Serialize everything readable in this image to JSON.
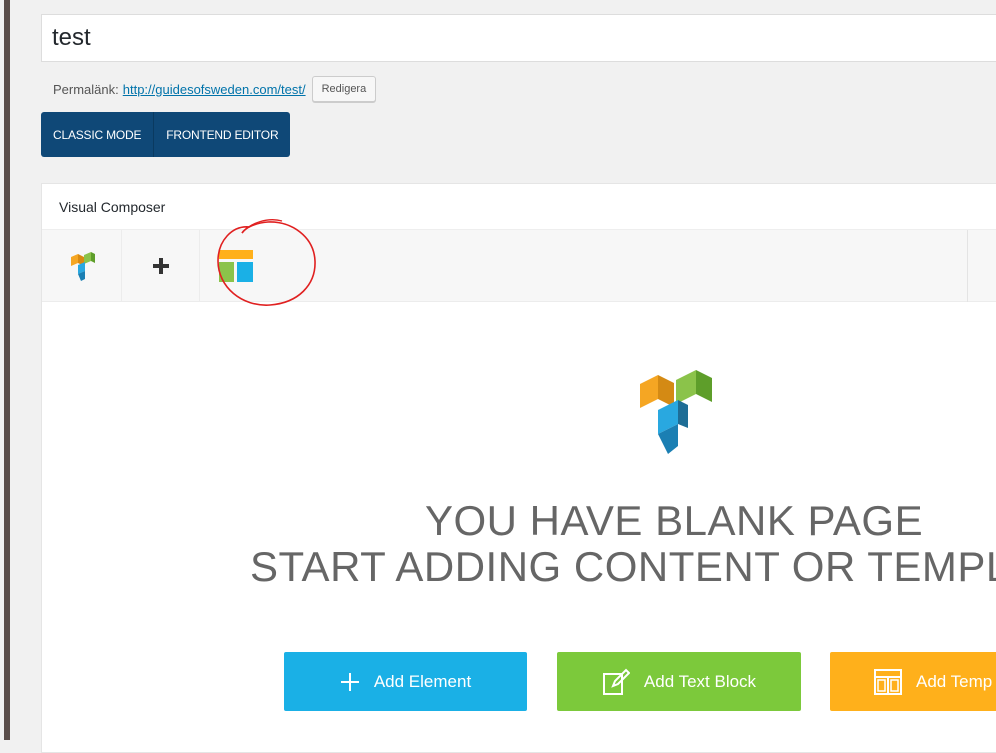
{
  "post": {
    "title_value": "test",
    "permalink_label": "Permalänk:",
    "permalink_url": "http://guidesofsweden.com/test/",
    "permalink_edit": "Redigera"
  },
  "modes": {
    "classic": "CLASSIC MODE",
    "frontend": "FRONTEND EDITOR"
  },
  "composer": {
    "title": "Visual Composer",
    "toolbar_icons": [
      "vc-logo-icon",
      "plus-icon",
      "templates-icon"
    ],
    "blank_line1": "YOU HAVE BLANK PAGE",
    "blank_line2": "START ADDING CONTENT OR TEMPL",
    "buttons": {
      "add_element": "Add Element",
      "add_text_block": "Add Text Block",
      "add_templates": "Add Temp"
    }
  },
  "colors": {
    "mode_button": "#0f4877",
    "add_element": "#1ab0e6",
    "add_text_block": "#7cc93b",
    "add_templates": "#ffb01b",
    "annotation": "#e02020"
  }
}
